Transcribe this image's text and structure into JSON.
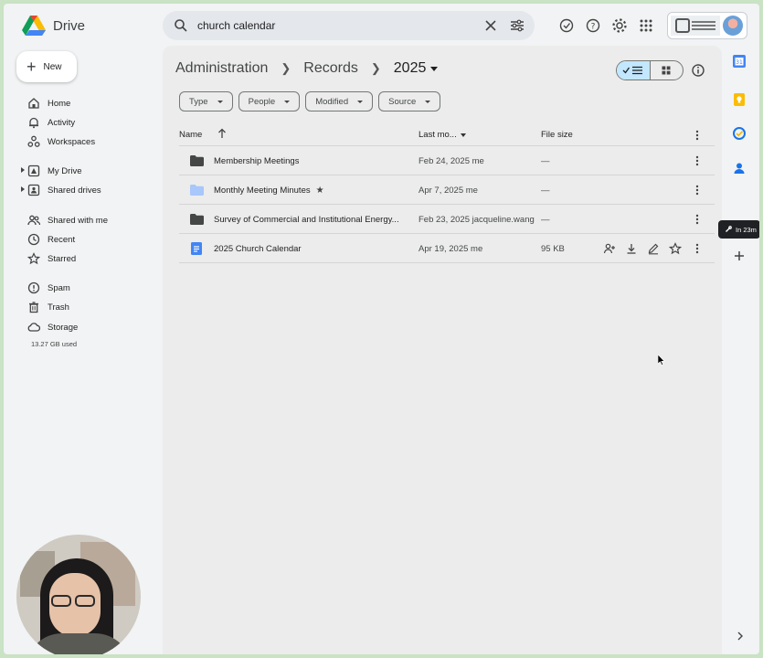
{
  "app": {
    "name": "Drive"
  },
  "search": {
    "query": "church calendar"
  },
  "new_button": {
    "label": "New"
  },
  "sidebar": {
    "items": [
      {
        "id": "home",
        "label": "Home",
        "icon": "home-icon"
      },
      {
        "id": "activity",
        "label": "Activity",
        "icon": "bell-icon"
      },
      {
        "id": "workspaces",
        "label": "Workspaces",
        "icon": "workspaces-icon"
      },
      {
        "id": "my-drive",
        "label": "My Drive",
        "icon": "drive-icon",
        "expandable": true
      },
      {
        "id": "shared-drives",
        "label": "Shared drives",
        "icon": "shared-drive-icon",
        "expandable": true
      },
      {
        "id": "shared-with-me",
        "label": "Shared with me",
        "icon": "people-icon"
      },
      {
        "id": "recent",
        "label": "Recent",
        "icon": "clock-icon"
      },
      {
        "id": "starred",
        "label": "Starred",
        "icon": "star-icon"
      },
      {
        "id": "spam",
        "label": "Spam",
        "icon": "spam-icon"
      },
      {
        "id": "trash",
        "label": "Trash",
        "icon": "trash-icon"
      },
      {
        "id": "storage",
        "label": "Storage",
        "icon": "cloud-icon"
      }
    ],
    "storage_used": "13.27 GB used"
  },
  "breadcrumb": {
    "items": [
      "Administration",
      "Records",
      "2025"
    ]
  },
  "filters": [
    "Type",
    "People",
    "Modified",
    "Source"
  ],
  "table": {
    "columns": {
      "name": "Name",
      "modified": "Last mo...",
      "size": "File size"
    },
    "rows": [
      {
        "name": "Membership Meetings",
        "modified": "Feb 24, 2025 me",
        "size": "—",
        "kind": "folder",
        "color": "#444746"
      },
      {
        "name": "Monthly Meeting Minutes",
        "modified": "Apr 7, 2025 me",
        "size": "—",
        "kind": "folder",
        "color": "#a8c7fa",
        "starred": true
      },
      {
        "name": "Survey of Commercial and Institutional Energy...",
        "modified": "Feb 23, 2025 jacqueline.wang",
        "size": "—",
        "kind": "folder",
        "color": "#444746"
      },
      {
        "name": "2025 Church Calendar",
        "modified": "Apr 19, 2025 me",
        "size": "95 KB",
        "kind": "doc",
        "color": "#4285f4"
      }
    ]
  },
  "tooltip": {
    "text": "In 23m"
  },
  "colors": {
    "accent": "#c2e7ff",
    "doc_blue": "#4285f4"
  }
}
